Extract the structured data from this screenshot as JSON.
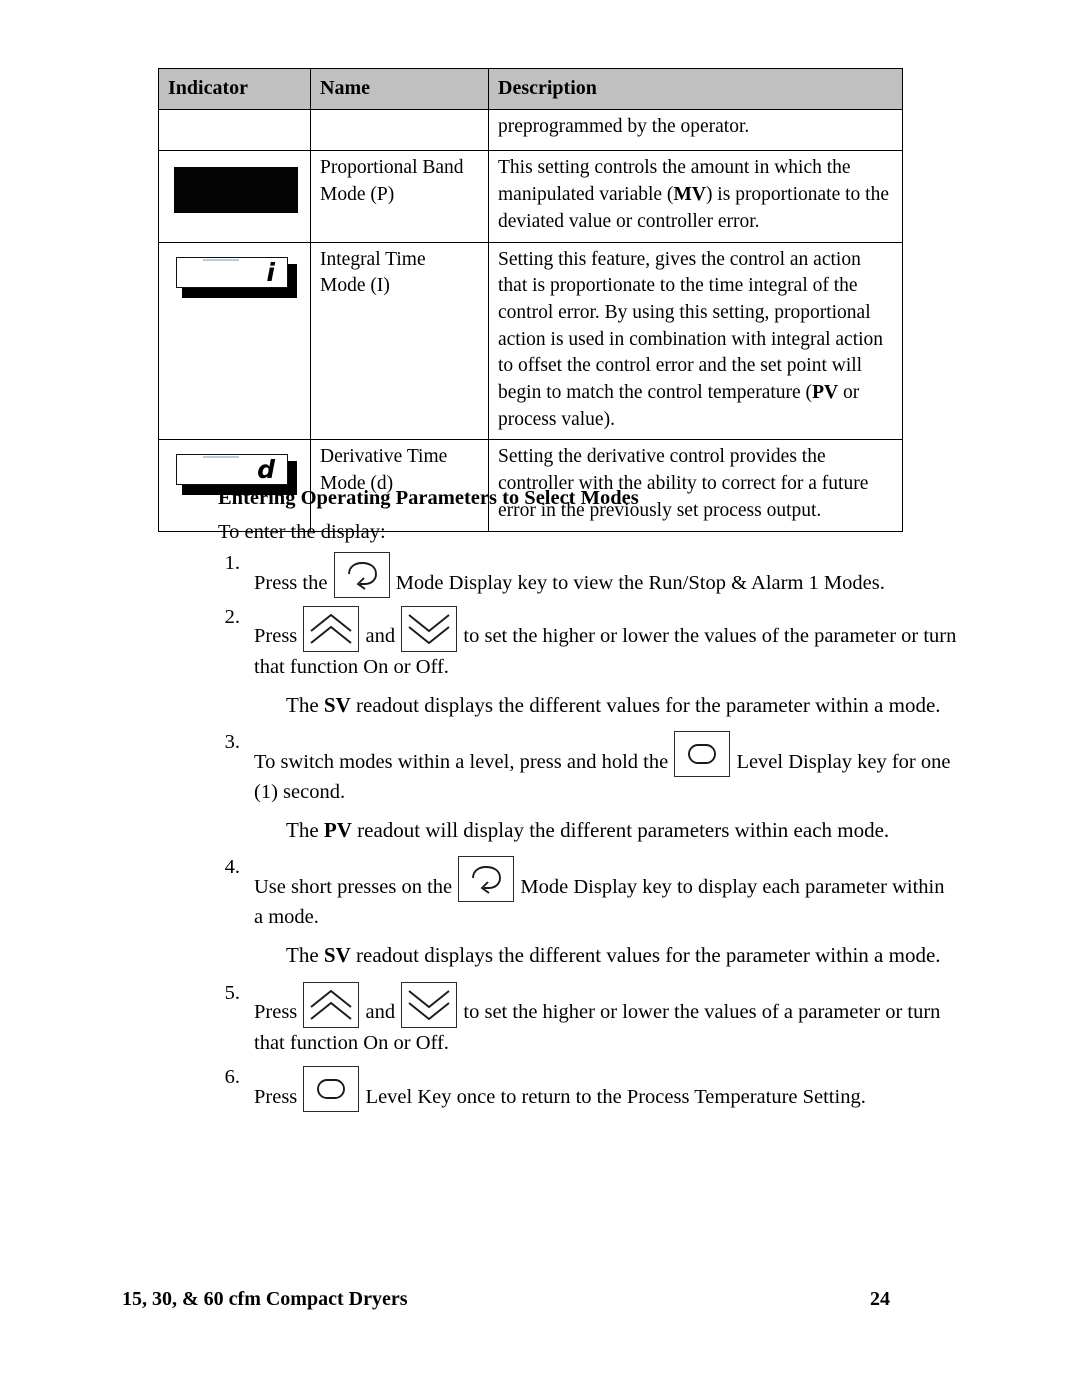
{
  "table": {
    "headers": [
      "Indicator",
      "Name",
      "Description"
    ],
    "rows": [
      {
        "indicator": "none",
        "name": "",
        "description": "preprogrammed by the operator."
      },
      {
        "indicator": "led-blank-black",
        "indicator_glyph": "",
        "name_line1": "Proportional Band",
        "name_line2": "Mode (P)",
        "description_parts": [
          {
            "text": "This setting controls the amount in which the manipulated variable ("
          },
          {
            "text": "MV",
            "bold": true
          },
          {
            "text": ") is proportionate to the deviated value or controller error."
          }
        ]
      },
      {
        "indicator": "led-display",
        "indicator_glyph": "i",
        "name_line1": "Integral Time",
        "name_line2": "Mode (I)",
        "description_parts": [
          {
            "text": "Setting this feature, gives the control an action that is proportionate to the time integral of the control error.  By using this setting, proportional action is used in combination with integral action to offset the control error and the set point will begin to match the control temperature ("
          },
          {
            "text": "PV",
            "bold": true
          },
          {
            "text": " or process value)."
          }
        ]
      },
      {
        "indicator": "led-display",
        "indicator_glyph": "d",
        "name_line1": "Derivative Time",
        "name_line2": "Mode (d)",
        "description_parts": [
          {
            "text": "Setting the derivative control provides the controller with the ability to correct for a future error in the previously set process output."
          }
        ]
      }
    ]
  },
  "section": {
    "heading": "Entering Operating Parameters to Select Modes",
    "intro": "To enter the display:"
  },
  "steps": [
    {
      "number": "1.",
      "pre": "Press the",
      "icon": "mode-display-key-icon",
      "post": "Mode Display key to view the Run/Stop & Alarm 1 Modes."
    },
    {
      "number": "2.",
      "pre": "Press",
      "icon": "up-arrow-key-icon",
      "mid": "and",
      "icon2": "down-arrow-key-icon",
      "post": "to set the higher or lower the values of the parameter or turn",
      "post2": "that function On or Off."
    },
    {
      "number": "3.",
      "pre": "To switch modes within a level, press and hold the",
      "icon": "level-display-key-icon",
      "post": "Level Display key for one",
      "post2": "(1) second."
    },
    {
      "number": "4.",
      "pre": "Use short presses on the",
      "icon": "mode-display-key-icon",
      "post": "Mode Display key to display each parameter within",
      "post2": "a mode."
    },
    {
      "number": "5.",
      "pre": "Press",
      "icon": "up-arrow-key-icon",
      "mid": "and",
      "icon2": "down-arrow-key-icon",
      "post": "to set the higher or lower the values of a parameter or turn",
      "post2": "that function On or Off."
    },
    {
      "number": "6.",
      "pre": "Press",
      "icon": "level-display-key-icon",
      "post": "Level Key once to return to the Process Temperature Setting."
    }
  ],
  "notes": {
    "sv_note_1_prefix": "The ",
    "sv_note_1_bold": "SV",
    "sv_note_1_suffix": " readout displays the different values for the parameter within a mode.",
    "pv_note_prefix": "The ",
    "pv_note_bold": "PV",
    "pv_note_suffix": " readout will display the different parameters within each mode.",
    "sv_note_2_prefix": "The ",
    "sv_note_2_bold": "SV",
    "sv_note_2_suffix": " readout displays the different values for the parameter within a mode."
  },
  "footer": {
    "title": "15, 30, & 60 cfm Compact Dryers",
    "page_number": "24"
  },
  "colors": {
    "header_bg": "#c0c0c0",
    "border": "#000000",
    "text": "#000000"
  }
}
